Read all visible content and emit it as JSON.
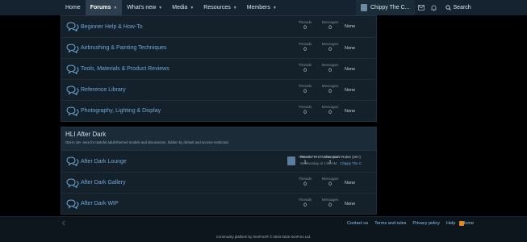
{
  "nav": {
    "tabs": [
      {
        "label": "Home"
      },
      {
        "label": "Forums"
      },
      {
        "label": "What's new"
      },
      {
        "label": "Media"
      },
      {
        "label": "Resources"
      },
      {
        "label": "Members"
      }
    ],
    "user": "Chippy The C...",
    "search": "Search"
  },
  "forum_block_1": {
    "nodes": [
      {
        "title": "Beginner Help & How-To",
        "threads": "0",
        "messages": "0",
        "latest": "None"
      },
      {
        "title": "Airbrushing & Painting Techniques",
        "threads": "0",
        "messages": "0",
        "latest": "None"
      },
      {
        "title": "Tools, Materials & Product Reviews",
        "threads": "0",
        "messages": "0",
        "latest": "None"
      },
      {
        "title": "Reference Library",
        "threads": "0",
        "messages": "0",
        "latest": "None"
      },
      {
        "title": "Photography, Lighting & Display",
        "threads": "0",
        "messages": "0",
        "latest": "None"
      }
    ]
  },
  "stat_labels": {
    "threads": "Threads",
    "messages": "Messages"
  },
  "forum_block_2": {
    "title": "HLI After Dark",
    "description": "Opt-in 18+ area for tasteful adult-themed models and discussions, hidden by default and access-restricted.",
    "nodes": [
      {
        "title": "After Dark Lounge",
        "threads": "1",
        "messages": "1",
        "latest_title": "READ FIRST: After Dark Rules (18+)",
        "latest_date": "Wednesday at 1:09 AM",
        "latest_user": "Chippy The C"
      },
      {
        "title": "After Dark Gallery",
        "threads": "0",
        "messages": "0",
        "latest": "None"
      },
      {
        "title": "After Dark WIP",
        "threads": "0",
        "messages": "0",
        "latest": "None"
      }
    ]
  },
  "footer": {
    "links": [
      "Contact us",
      "Terms and rules",
      "Privacy policy",
      "Help",
      "Home"
    ],
    "copyright": "Community platform by XenForo® © 2010-2025 XenForo Ltd."
  },
  "colors": {
    "accent": "#6ea8d8",
    "rss": "#e88a1a"
  }
}
